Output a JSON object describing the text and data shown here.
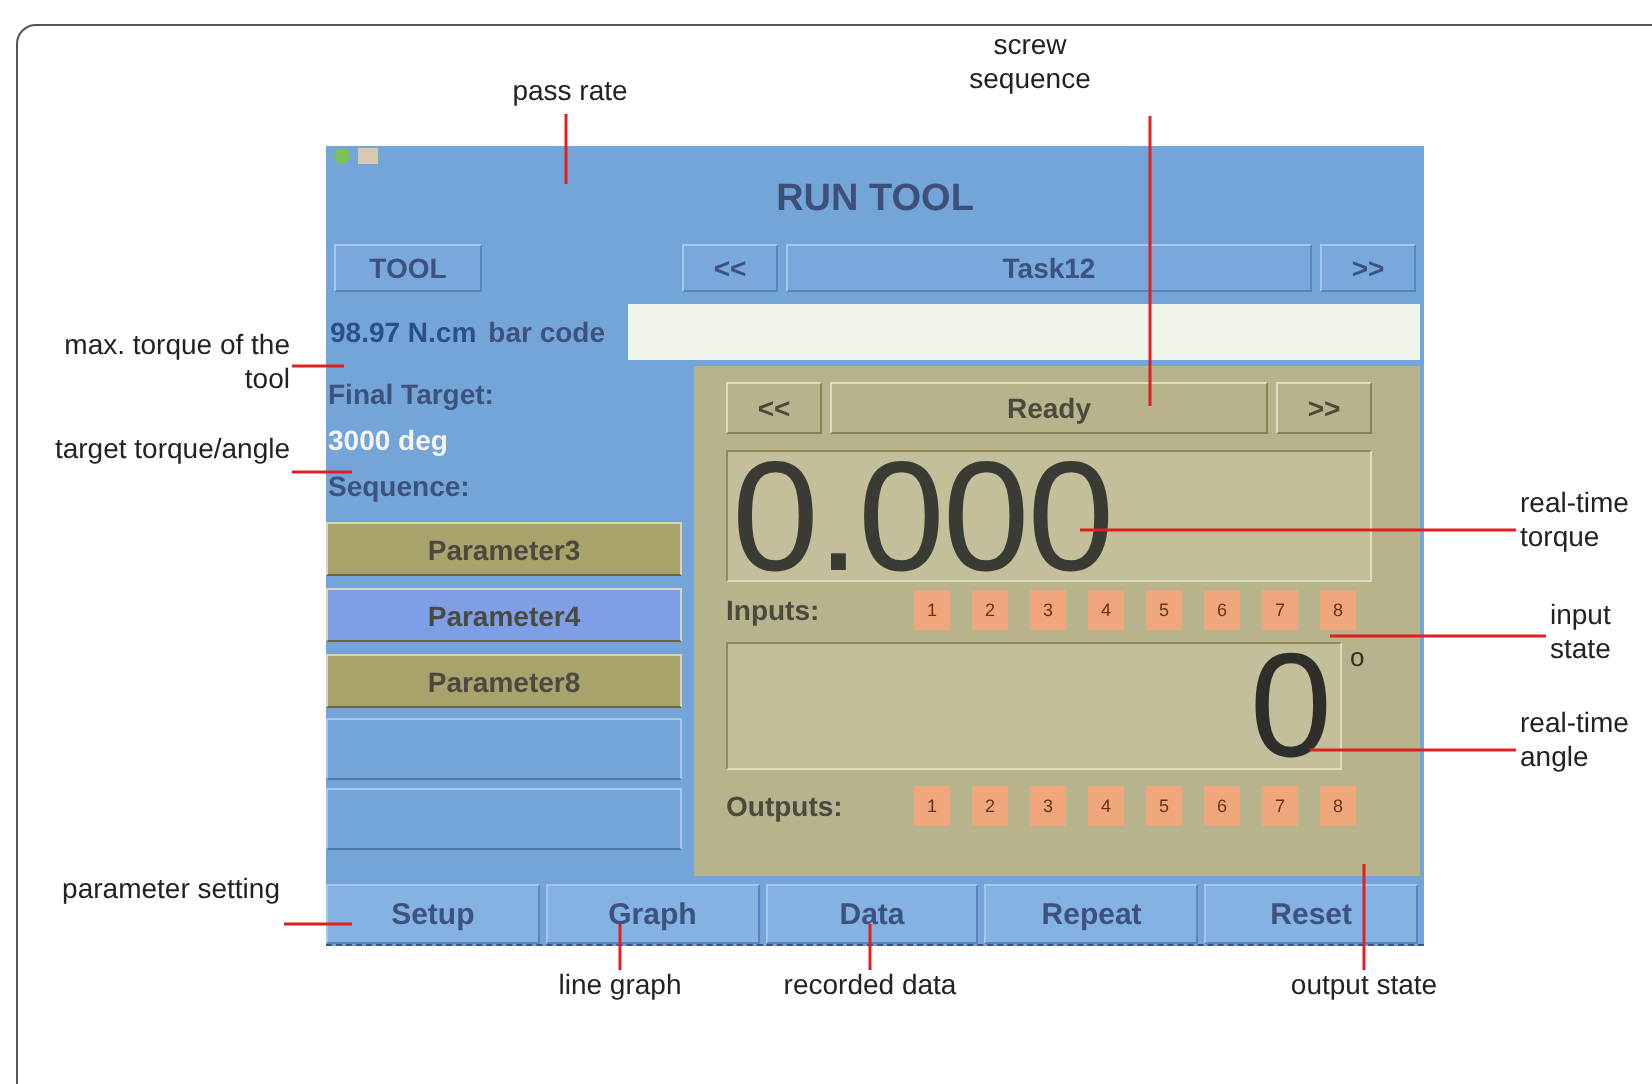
{
  "screen": {
    "title": "RUN TOOL",
    "tool_button": "TOOL",
    "task_prev": "<<",
    "task": "Task12",
    "task_next": ">>",
    "max_torque": "98.97 N.cm",
    "barcode_label": "bar code",
    "final_target_label": "Final Target:",
    "final_target": "3000 deg",
    "sequence_label": "Sequence:",
    "sequence": [
      {
        "label": "Parameter3",
        "color": "#a8a36a"
      },
      {
        "label": "Parameter4",
        "color": "#7e9ee6"
      },
      {
        "label": "Parameter8",
        "color": "#a8a36a"
      }
    ],
    "step_prev": "<<",
    "step": "Ready",
    "step_next": ">>",
    "torque": "0.000",
    "angle": "0",
    "angle_unit": "o",
    "inputs_label": "Inputs:",
    "inputs": [
      "1",
      "2",
      "3",
      "4",
      "5",
      "6",
      "7",
      "8"
    ],
    "outputs_label": "Outputs:",
    "outputs": [
      "1",
      "2",
      "3",
      "4",
      "5",
      "6",
      "7",
      "8"
    ],
    "tabs": [
      "Setup",
      "Graph",
      "Data",
      "Repeat",
      "Reset"
    ]
  },
  "annotations": [
    "pass rate",
    "screw sequence",
    "max. torque of the tool",
    "target torque/angle",
    "parameter setting",
    "real-time torque",
    "input state",
    "real-time angle",
    "line graph",
    "recorded data",
    "output state"
  ]
}
